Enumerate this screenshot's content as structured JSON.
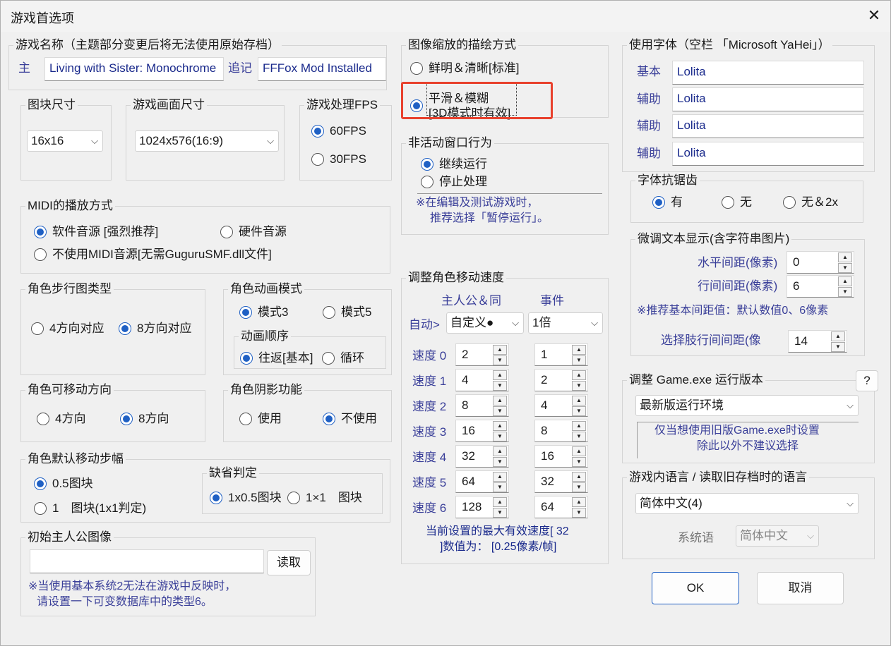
{
  "window": {
    "title": "游戏首选项",
    "close": "✕"
  },
  "game_name": {
    "label": "游戏名称（主题部分变更后将无法使用原始存档）",
    "main_label": "主",
    "main_value": "Living with Sister: Monochrome",
    "sub_label": "追记",
    "sub_value": "FFFox Mod Installed"
  },
  "scaling": {
    "label": "图像缩放的描绘方式",
    "opt1": "鲜明＆清晰[标准]",
    "opt2_line1": "平滑＆模糊",
    "opt2_line2": "[3D模式时有效]"
  },
  "font": {
    "label": "使用字体（空栏 「Microsoft YaHei」）",
    "rows": [
      {
        "label": "基本",
        "value": "Lolita"
      },
      {
        "label": "辅助",
        "value": "Lolita"
      },
      {
        "label": "辅助",
        "value": "Lolita"
      },
      {
        "label": "辅助",
        "value": "Lolita"
      }
    ]
  },
  "tile": {
    "label": "图块尺寸",
    "value": "16x16"
  },
  "screen": {
    "label": "游戏画面尺寸",
    "value": "1024x576(16:9)"
  },
  "fps": {
    "label": "游戏处理FPS",
    "opt1": "60FPS",
    "opt2": "30FPS"
  },
  "inactive": {
    "label": "非活动窗口行为",
    "opt1": "继续运行",
    "opt2": "停止处理",
    "note1": "※在编辑及测试游戏时，",
    "note2": "推荐选择「暂停运行」。"
  },
  "antialias": {
    "label": "字体抗锯齿",
    "opt1": "有",
    "opt2": "无",
    "opt3": "无＆2x"
  },
  "midi": {
    "label": "MIDI的播放方式",
    "opt1": "软件音源 [强烈推荐]",
    "opt2": "硬件音源",
    "opt3": "不使用MIDI音源[无需GuguruSMF.dll文件]"
  },
  "text_adjust": {
    "label": "微调文本显示(含字符串图片)",
    "h_label": "水平间距(像素)",
    "h_value": "0",
    "v_label": "行间间距(像素)",
    "v_value": "6",
    "note": "※推荐基本间距值：默认数值0、6像素",
    "choice_label": "选择肢行间间距(像",
    "choice_value": "14"
  },
  "walk": {
    "label": "角色步行图类型",
    "opt1": "4方向对应",
    "opt2": "8方向对应"
  },
  "anim": {
    "label": "角色动画模式",
    "opt1": "模式3",
    "opt2": "模式5",
    "order_label": "动画顺序",
    "order1": "往返[基本]",
    "order2": "循环"
  },
  "speed": {
    "label": "调整角色移动速度",
    "col1": "主人公＆同",
    "col2": "事件",
    "auto_label": "自动>",
    "auto_value": "自定义●",
    "mult_value": "1倍",
    "rows": [
      {
        "label": "速度 0",
        "a": "2",
        "b": "1"
      },
      {
        "label": "速度 1",
        "a": "4",
        "b": "2"
      },
      {
        "label": "速度 2",
        "a": "8",
        "b": "4"
      },
      {
        "label": "速度 3",
        "a": "16",
        "b": "8"
      },
      {
        "label": "速度 4",
        "a": "32",
        "b": "16"
      },
      {
        "label": "速度 5",
        "a": "64",
        "b": "32"
      },
      {
        "label": "速度 6",
        "a": "128",
        "b": "64"
      }
    ],
    "note1": "当前设置的最大有效速度[ 32",
    "note2": "]数值为：  [0.25像素/帧]"
  },
  "direction": {
    "label": "角色可移动方向",
    "opt1": "4方向",
    "opt2": "8方向"
  },
  "shadow": {
    "label": "角色阴影功能",
    "opt1": "使用",
    "opt2": "不使用"
  },
  "exe": {
    "label": "调整 Game.exe 运行版本",
    "help": "?",
    "value": "最新版运行环境",
    "note1": "仅当想使用旧版Game.exe时设置",
    "note2": "除此以外不建议选择"
  },
  "step": {
    "label": "角色默认移动步幅",
    "opt1": "0.5图块",
    "opt2": "1　图块(1x1判定)"
  },
  "hit": {
    "label": "缺省判定",
    "opt1": "1x0.5图块",
    "opt2": "1×1　图块"
  },
  "lang": {
    "label": "游戏内语言 / 读取旧存档时的语言",
    "value": "简体中文(4)",
    "sys_label": "系统语",
    "sys_value": "简体中文"
  },
  "hero": {
    "label": "初始主人公图像",
    "value": "",
    "load": "读取",
    "note1": "※当使用基本系统2无法在游戏中反映时，",
    "note2": "请设置一下可变数据库中的类型6。"
  },
  "buttons": {
    "ok": "OK",
    "cancel": "取消"
  },
  "icons": {
    "spin_up": "▲",
    "spin_down": "▼",
    "chevron": "⌵"
  }
}
